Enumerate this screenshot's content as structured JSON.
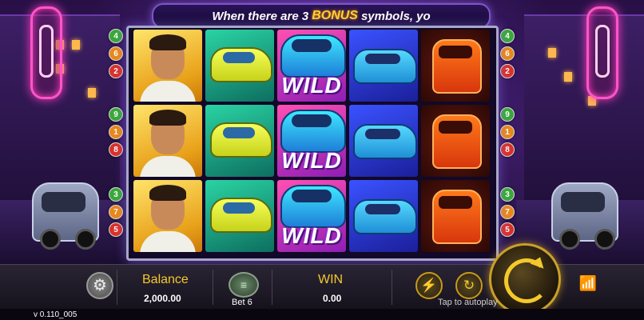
{
  "banner": {
    "prefix": "When there are 3",
    "highlight": "BONUS",
    "suffix": "symbols, yo"
  },
  "reels": [
    {
      "symbols": [
        "man",
        "man",
        "man"
      ]
    },
    {
      "symbols": [
        "taxi",
        "taxi",
        "taxi"
      ]
    },
    {
      "symbols": [
        "wild",
        "wild",
        "wild"
      ]
    },
    {
      "symbols": [
        "blue-taxi",
        "blue-taxi",
        "blue-taxi"
      ]
    },
    {
      "symbols": [
        "tuk-tuk",
        "tuk-tuk",
        "tuk-tuk"
      ]
    }
  ],
  "wild_label": "WILD",
  "paylines": {
    "left": [
      "4",
      "6",
      "2",
      "9",
      "1",
      "8",
      "3",
      "7",
      "5"
    ],
    "right": [
      "4",
      "6",
      "2",
      "9",
      "1",
      "8",
      "3",
      "7",
      "5"
    ],
    "colors": {
      "green": "#3aa83a",
      "orange": "#e8891a",
      "red": "#d8322a"
    }
  },
  "bottom_bar": {
    "balance_label": "Balance",
    "balance_value": "2,000.00",
    "bet_label": "Bet 6",
    "win_label": "WIN",
    "win_value": "0.00",
    "autoplay_hint": "Tap to autoplay"
  },
  "icons": {
    "settings": "gear-icon",
    "bet": "chip-icon",
    "turbo": "lightning-icon",
    "auto": "autoplay-icon",
    "spin": "spin-icon",
    "network": "wifi-icon"
  },
  "version": "v 0.110_005",
  "colors": {
    "accent_gold": "#f4c92a",
    "bonus_yellow": "#ffd233"
  }
}
